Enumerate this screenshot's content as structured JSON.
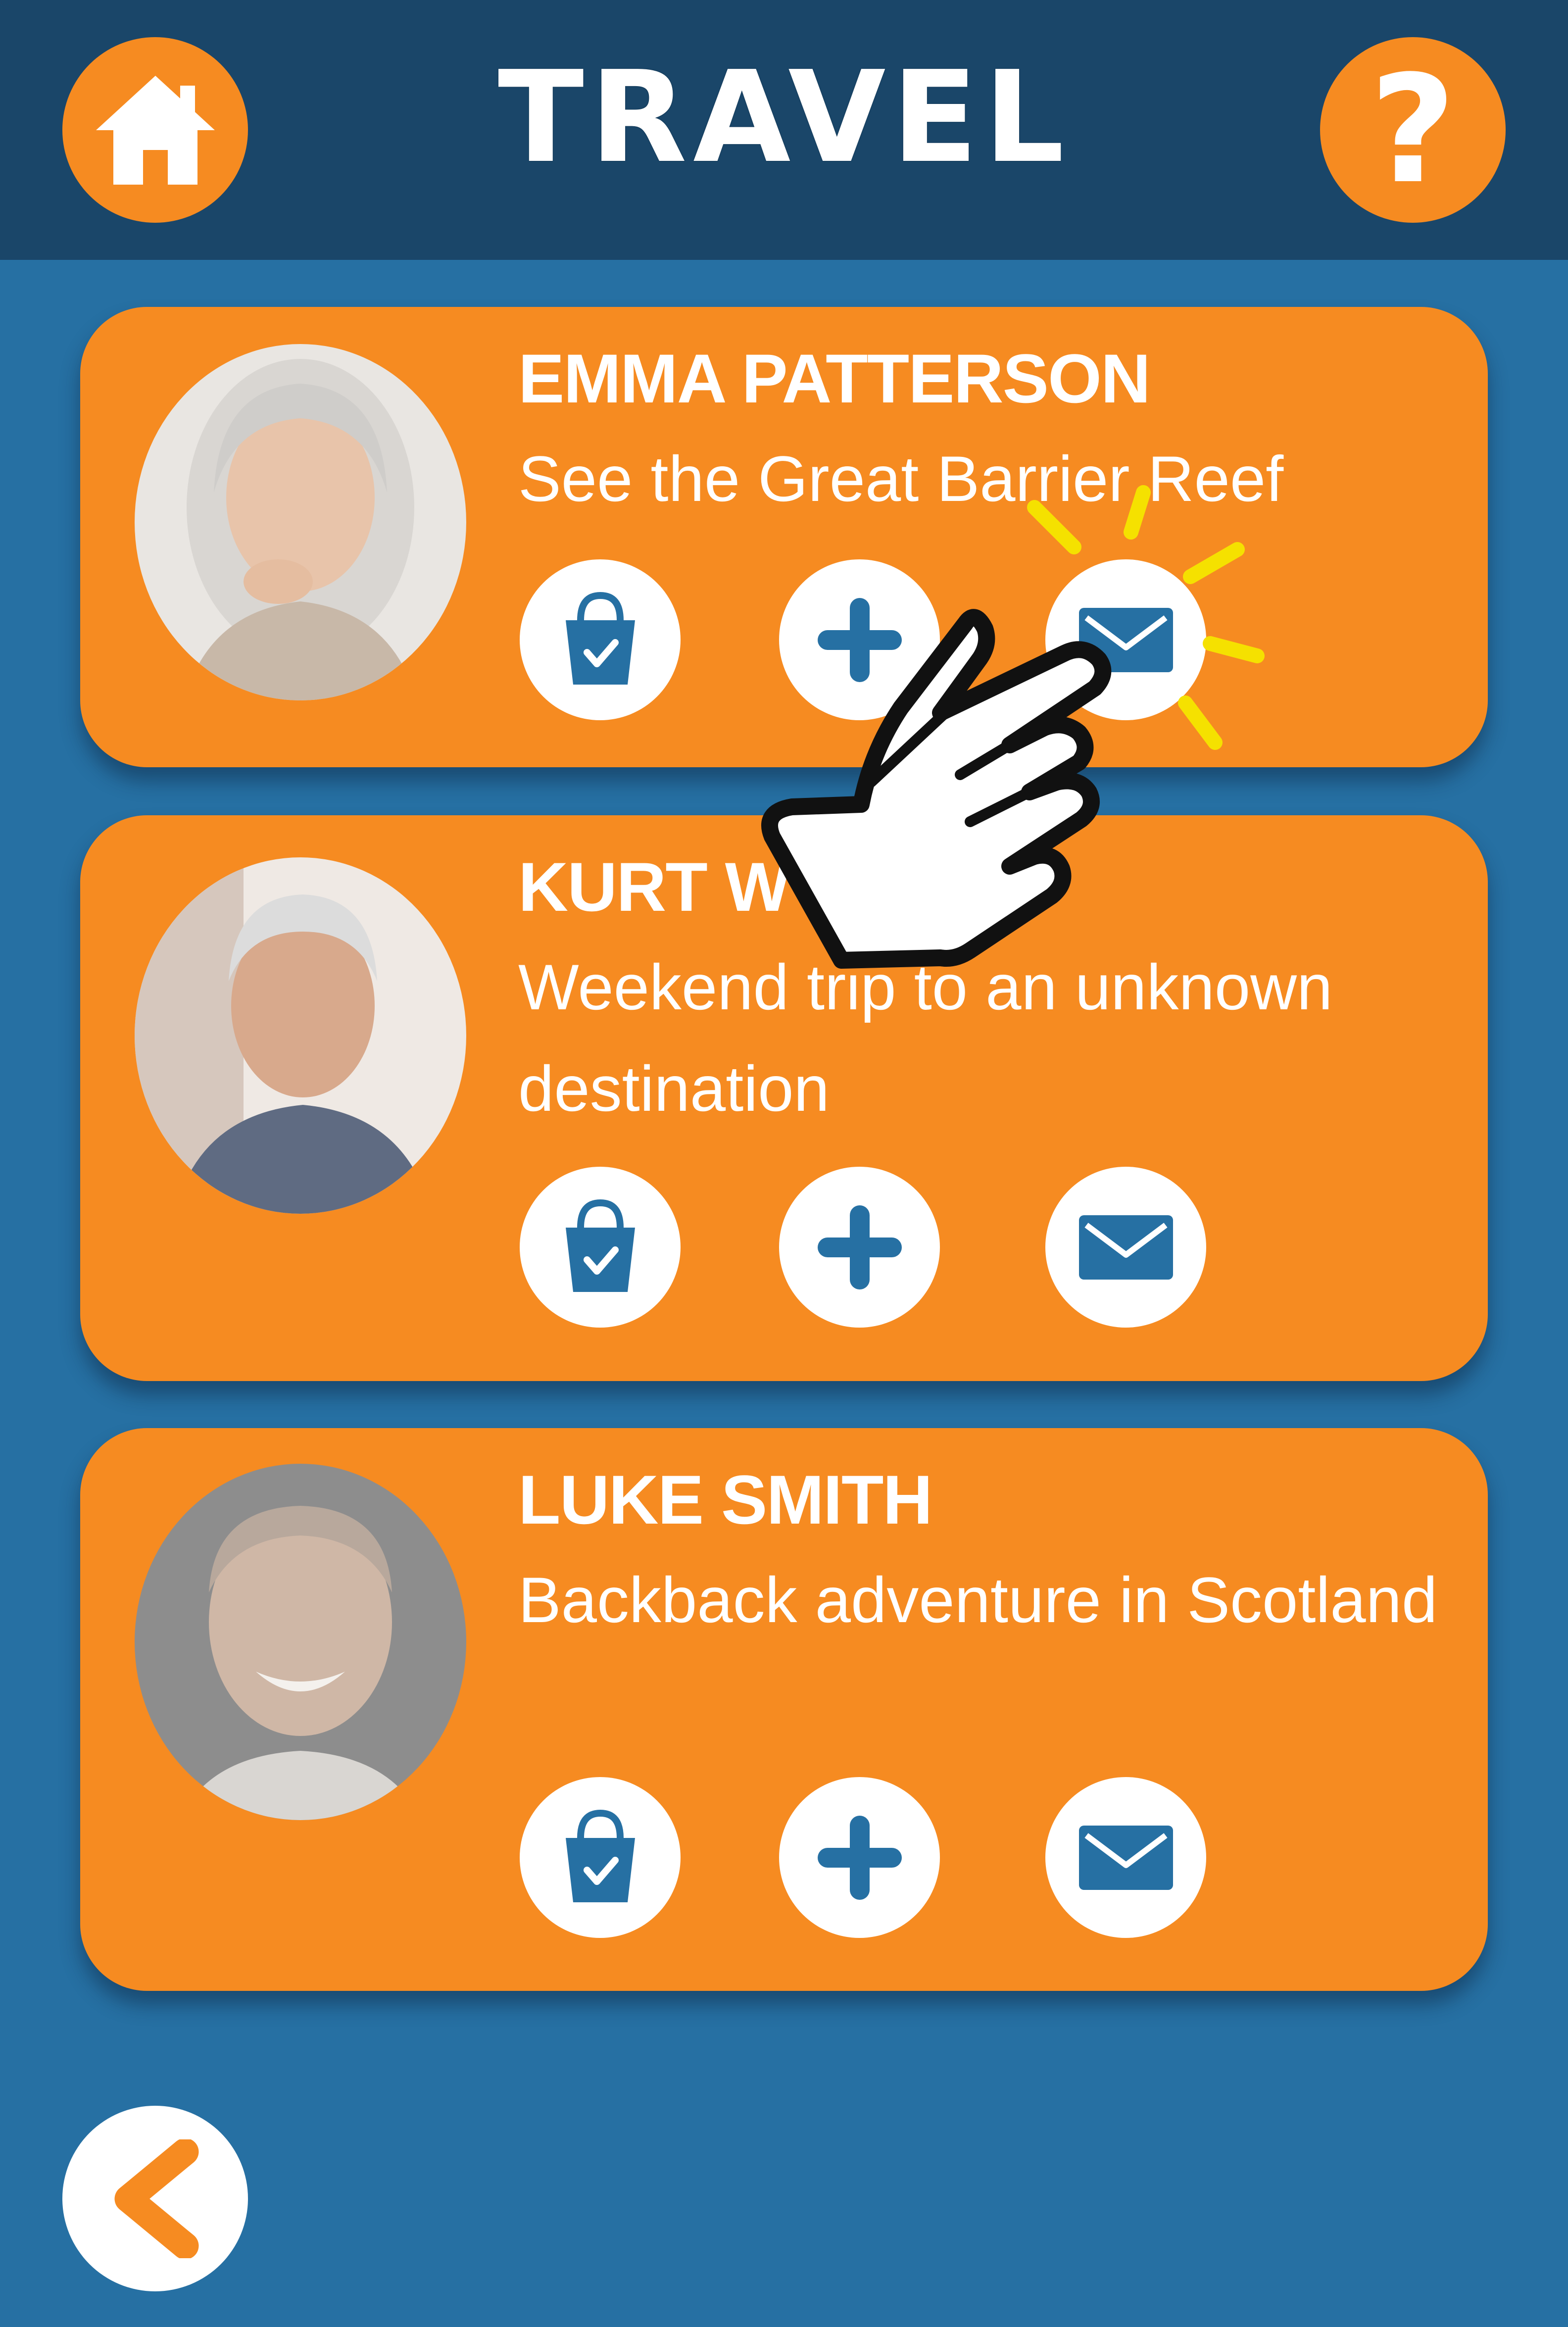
{
  "header": {
    "title": "TRAVEL",
    "help_label": "?"
  },
  "colors": {
    "background": "#2670a3",
    "header": "#1a4669",
    "accent_orange": "#f68b21",
    "icon_blue": "#2670a3",
    "highlight_yellow": "#f5e100"
  },
  "cards": [
    {
      "name": "EMMA PATTERSON",
      "description": "See the Great Barrier Reef",
      "actions": [
        "basket-icon",
        "plus-icon",
        "mail-icon"
      ]
    },
    {
      "name": "KURT W",
      "description": "Weekend trip to an unknown destination",
      "actions": [
        "basket-icon",
        "plus-icon",
        "mail-icon"
      ]
    },
    {
      "name": "LUKE SMITH",
      "description": "Backback adventure in Scotland",
      "actions": [
        "basket-icon",
        "plus-icon",
        "mail-icon"
      ]
    }
  ],
  "footer": {
    "back_icon": "chevron-left-icon"
  },
  "overlay": {
    "pointer_icon": "pointing-hand-icon",
    "tap_indicator": "tap-sparkle-icon"
  }
}
